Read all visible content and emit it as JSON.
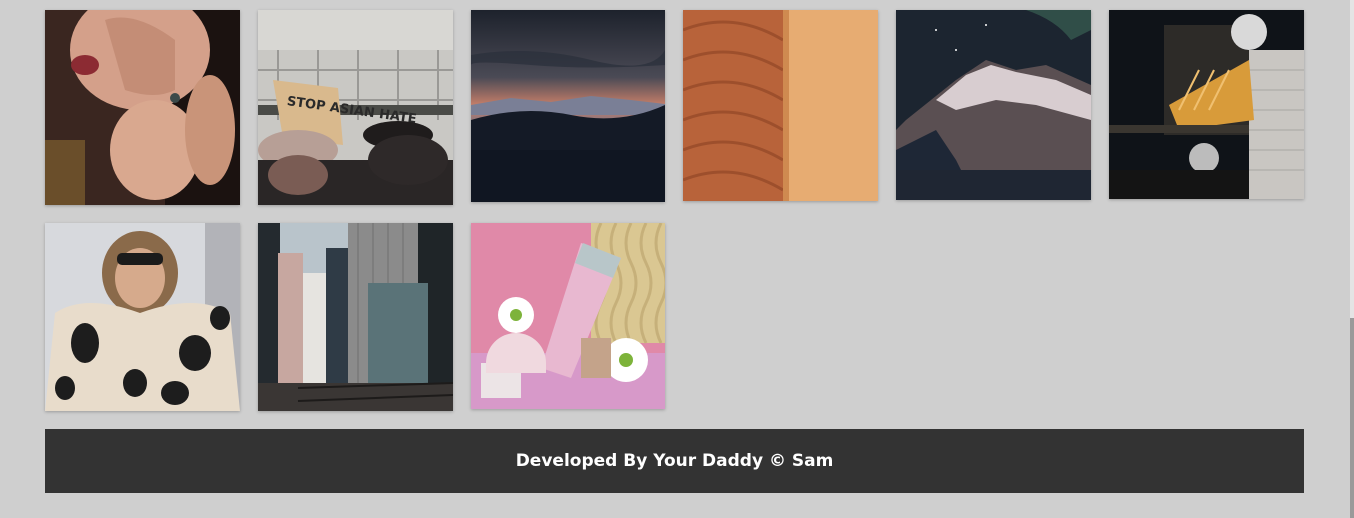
{
  "gallery": {
    "photos": [
      {
        "subject": "woman-earring"
      },
      {
        "subject": "protest-stop-asian-hate"
      },
      {
        "subject": "dusk-mountains"
      },
      {
        "subject": "sand-dune"
      },
      {
        "subject": "aurora-mountain"
      },
      {
        "subject": "rooftop-night"
      },
      {
        "subject": "woman-sunglasses"
      },
      {
        "subject": "city-skyscrapers"
      },
      {
        "subject": "pink-tube-daisies"
      }
    ],
    "protest_sign_text": "STOP ASIAN HATE"
  },
  "footer": {
    "text": "Developed By Your Daddy © Sam"
  },
  "colors": {
    "background": "#cfcfcf",
    "footer": "#333333",
    "footer_text": "#ffffff"
  }
}
